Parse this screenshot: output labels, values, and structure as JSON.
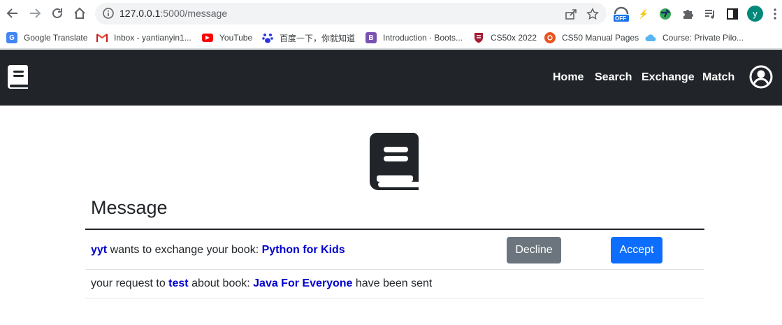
{
  "browser": {
    "url_host": "127.0.0.1",
    "url_path": ":5000/message",
    "ext_off_badge": "OFF",
    "profile_initial": "y"
  },
  "bookmarks": [
    {
      "label": "Google Translate",
      "icon": "google-translate-icon"
    },
    {
      "label": "Inbox - yantianyin1...",
      "icon": "gmail-icon"
    },
    {
      "label": "YouTube",
      "icon": "youtube-icon"
    },
    {
      "label": "百度一下，你就知道",
      "icon": "baidu-icon"
    },
    {
      "label": "Introduction · Boots...",
      "icon": "bootstrap-icon",
      "glyph": "B"
    },
    {
      "label": "CS50x 2022",
      "icon": "harvard-shield-icon"
    },
    {
      "label": "CS50 Manual Pages",
      "icon": "ubuntu-icon"
    },
    {
      "label": "Course: Private Pilo...",
      "icon": "cloud-icon"
    }
  ],
  "navbar": {
    "links": [
      "Home",
      "Search",
      "Exchange",
      "Match"
    ]
  },
  "page": {
    "title": "Message"
  },
  "messages": [
    {
      "user": "yyt",
      "mid_text": " wants to exchange your book: ",
      "book": "Python for Kids",
      "decline_label": "Decline",
      "accept_label": "Accept"
    },
    {
      "prefix": "your request to ",
      "user": "test",
      "mid_text": " about book: ",
      "book": "Java For Everyone",
      "suffix": " have been sent"
    }
  ],
  "colors": {
    "navbar_bg": "#212529",
    "highlight": "#0000cc",
    "decline": "#6c757d",
    "accept": "#0d6efd"
  }
}
